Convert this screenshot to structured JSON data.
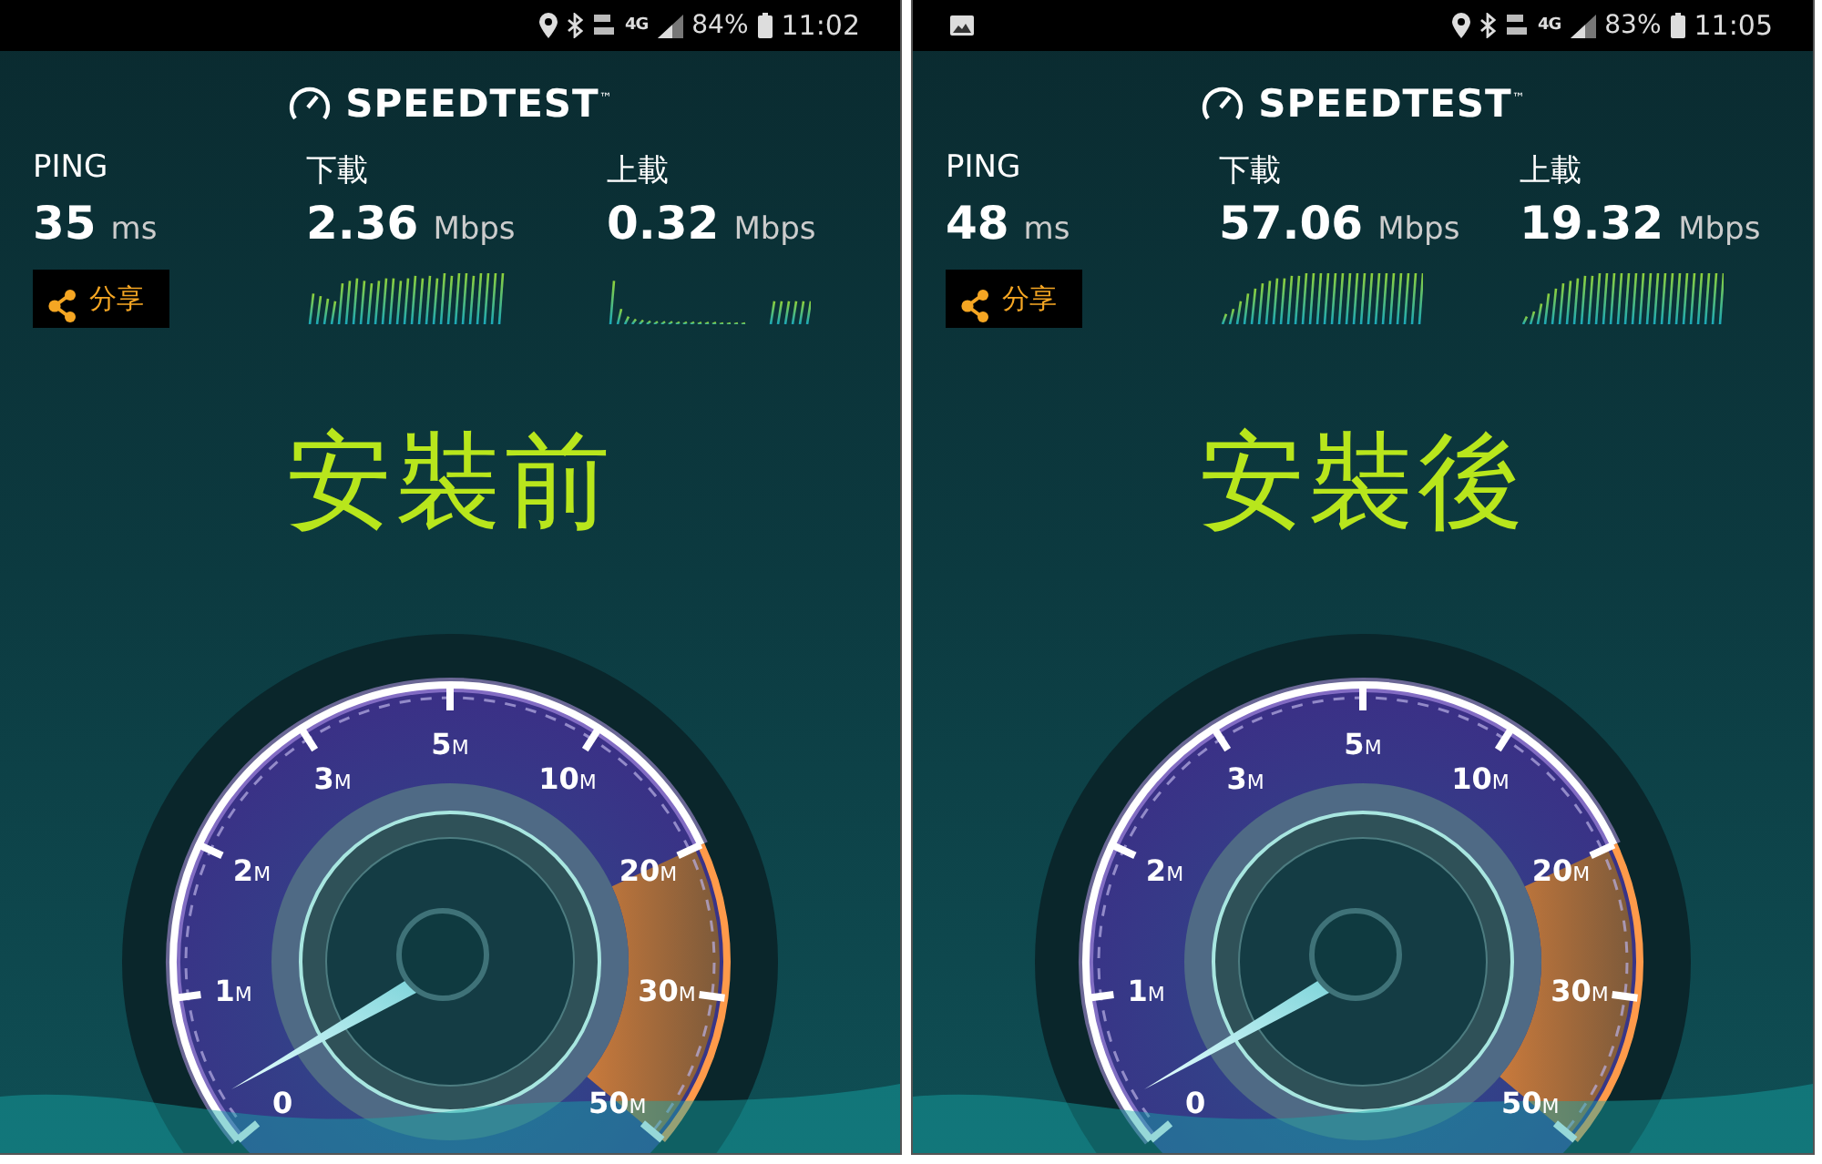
{
  "screens": [
    {
      "status_bar": {
        "network": "4G",
        "battery": "84%",
        "time": "11:02"
      },
      "logo": "SPEEDTEST$^{™}$",
      "ping": {
        "label": "PING",
        "value": "35",
        "unit": "ms"
      },
      "download": {
        "label": "下載",
        "value": "2.36",
        "unit": "Mbps"
      },
      "upload": {
        "label": "上載",
        "value": "0.32",
        "unit": "Mbps"
      },
      "share_button": {
        "label": "分享"
      },
      "caption": "安裝前",
      "gauge_ticks": [
        {
          "value": "0"
        },
        {
          "value": "1",
          "unit": "M"
        },
        {
          "value": "2",
          "unit": "M"
        },
        {
          "value": "3",
          "unit": "M"
        },
        {
          "value": "5",
          "unit": "M"
        },
        {
          "value": "10",
          "unit": "M"
        },
        {
          "value": "20",
          "unit": "M"
        },
        {
          "value": "30",
          "unit": "M"
        },
        {
          "value": "50",
          "unit": "M"
        }
      ]
    },
    {
      "status_bar": {
        "notification_icon": {
          "kind": "image"
        },
        "network": "4G",
        "battery": "83%",
        "time": "11:05"
      },
      "logo": "SPEEDTEST$^{™}$",
      "ping": {
        "label": "PING",
        "value": "48",
        "unit": "ms"
      },
      "download": {
        "label": "下載",
        "value": "57.06",
        "unit": "Mbps"
      },
      "upload": {
        "label": "上載",
        "value": "19.32",
        "unit": "Mbps"
      },
      "share_button": {
        "label": "分享"
      },
      "caption": "安裝後",
      "gauge_ticks": [
        {
          "value": "0"
        },
        {
          "value": "1",
          "unit": "M"
        },
        {
          "value": "2",
          "unit": "M"
        },
        {
          "value": "3",
          "unit": "M"
        },
        {
          "value": "5",
          "unit": "M"
        },
        {
          "value": "10",
          "unit": "M"
        },
        {
          "value": "20",
          "unit": "M"
        },
        {
          "value": "30",
          "unit": "M"
        },
        {
          "value": "50",
          "unit": "M"
        }
      ]
    }
  ]
}
